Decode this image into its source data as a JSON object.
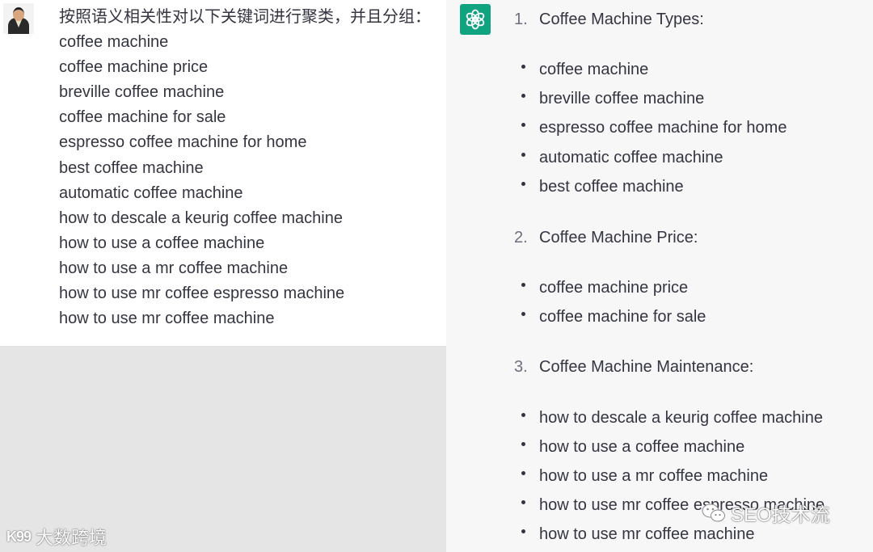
{
  "user": {
    "lines": [
      "按照语义相关性对以下关键词进行聚类，并且分组：",
      "coffee machine",
      "coffee machine price",
      "breville coffee machine",
      "coffee machine for sale",
      "espresso coffee machine for home",
      "best coffee machine",
      "automatic coffee machine",
      "how to descale a keurig coffee machine",
      "how to use a coffee machine",
      "how to use a mr coffee machine",
      "how to use mr coffee espresso machine",
      "how to use mr coffee machine"
    ]
  },
  "assistant": {
    "groups": [
      {
        "number": "1.",
        "title": "Coffee Machine Types:",
        "items": [
          "coffee machine",
          "breville coffee machine",
          "espresso coffee machine for home",
          "automatic coffee machine",
          "best coffee machine"
        ]
      },
      {
        "number": "2.",
        "title": "Coffee Machine Price:",
        "items": [
          "coffee machine price",
          "coffee machine for sale"
        ]
      },
      {
        "number": "3.",
        "title": "Coffee Machine Maintenance:",
        "items": [
          "how to descale a keurig coffee machine",
          "how to use a coffee machine",
          "how to use a mr coffee machine",
          "how to use mr coffee espresso machine",
          "how to use mr coffee machine"
        ]
      }
    ]
  },
  "watermarks": {
    "left": "大数跨境",
    "left_logo": "K99",
    "right": "SEO技术流"
  },
  "colors": {
    "gpt_green": "#10a37f",
    "text": "#343541",
    "assistant_bg": "#f7f7f8",
    "blank_area": "#e5e5e5"
  },
  "icons": {
    "user_avatar": "user-avatar-icon",
    "assistant_avatar": "openai-logo-icon",
    "wechat": "wechat-icon"
  }
}
